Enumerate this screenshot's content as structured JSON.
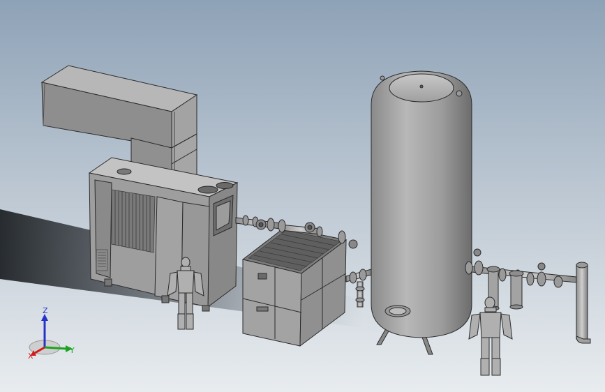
{
  "colors": {
    "bg_top": "#8fa3b8",
    "bg_bottom": "#e4e9ee",
    "shadow": "#2e3339",
    "metal": "#a9a9a9",
    "metal_dark": "#707070",
    "metal_light": "#c4c4c4",
    "edge": "#2a2a2a",
    "axis_x": "#d11b1b",
    "axis_y": "#1aa320",
    "axis_z": "#2533c9"
  },
  "triad": {
    "x_label": "X",
    "y_label": "Y",
    "z_label": "Z"
  },
  "objects": [
    "air-compressor",
    "exhaust-duct",
    "air-dryer",
    "air-receiver-tank",
    "piping",
    "valves",
    "filters",
    "human-figure-left",
    "human-figure-right"
  ]
}
